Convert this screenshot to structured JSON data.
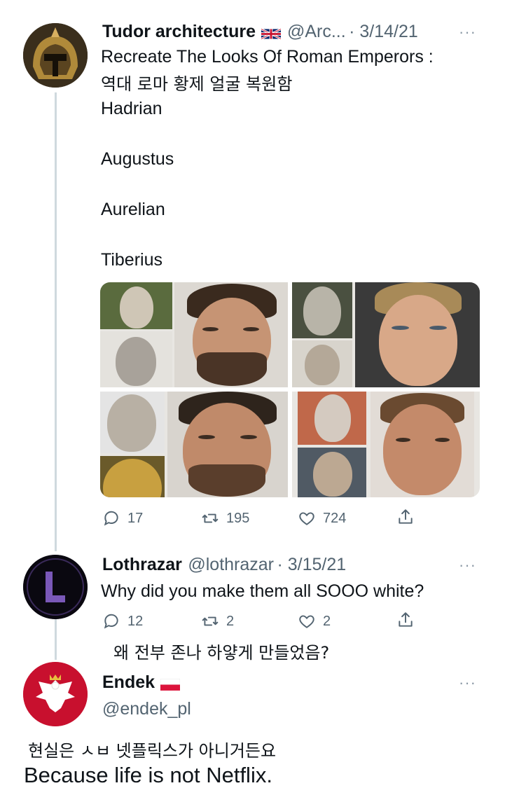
{
  "tweet1": {
    "display_name": "Tudor architecture",
    "handle": "@Arc...",
    "date": "· 3/14/21",
    "more": "···",
    "title": "Recreate The Looks Of Roman Emperors :",
    "subtitle_ko": "역대 로마 황제 얼굴 복원함",
    "names": [
      "Hadrian",
      "Augustus",
      "Aurelian",
      "Tiberius"
    ],
    "replies": "17",
    "retweets": "195",
    "likes": "724"
  },
  "tweet2": {
    "display_name": "Lothrazar",
    "handle": "@lothrazar",
    "date": "· 3/15/21",
    "more": "···",
    "text": "Why did you make them all SOOO white?",
    "replies": "12",
    "retweets": "2",
    "likes": "2",
    "caption_ko": "왜 전부 존나 하얗게 만들었음?"
  },
  "tweet3": {
    "display_name": "Endek",
    "handle": "@endek_pl",
    "more": "···",
    "caption_ko": "현실은 ㅅㅂ 넷플릭스가 아니거든요",
    "text": "Because life is not Netflix."
  },
  "colors": {
    "text": "#0f1419",
    "muted": "#536471",
    "thread_line": "#cfd9de"
  }
}
